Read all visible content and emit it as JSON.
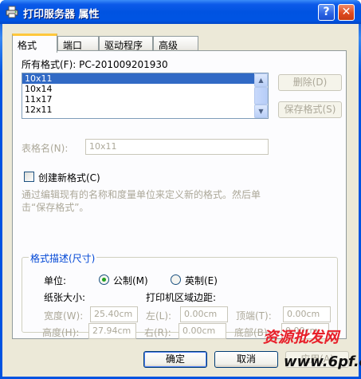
{
  "window": {
    "title": "打印服务器 属性",
    "help_label": "?",
    "close_label": "✕"
  },
  "tabs": [
    {
      "label": "格式",
      "active": true
    },
    {
      "label": "端口",
      "active": false
    },
    {
      "label": "驱动程序",
      "active": false
    },
    {
      "label": "高级",
      "active": false
    }
  ],
  "forms": {
    "label": "所有格式(F): PC-201009201930",
    "items": [
      "10x11",
      "10x14",
      "11x17",
      "12x11"
    ],
    "selected": "10x11",
    "delete_label": "删除(D)",
    "save_label": "保存格式(S)"
  },
  "form_name": {
    "label": "表格名(N):",
    "value": "10x11"
  },
  "create_new": {
    "label": "创建新格式(C)",
    "checked": false
  },
  "hint": "通过编辑现有的名称和度量单位来定义新的格式。然后单击“保存格式”。",
  "description": {
    "title": "格式描述(尺寸)",
    "unit_label": "单位:",
    "metric_label": "公制(M)",
    "english_label": "英制(E)",
    "selected_unit": "metric",
    "paper_size_label": "纸张大小:",
    "width_label": "宽度(W):",
    "width_value": "25.40cm",
    "height_label": "高度(H):",
    "height_value": "27.94cm",
    "margins_label": "打印机区域边距:",
    "left_label": "左(L):",
    "left_value": "0.00cm",
    "right_label": "右(R):",
    "right_value": "0.00cm",
    "top_label": "顶端(T):",
    "top_value": "0.00cm",
    "bottom_label": "底部(B):",
    "bottom_value": "0.00cm"
  },
  "footer": {
    "ok_label": "确定",
    "cancel_label": "取消",
    "apply_label": "应用(A)"
  },
  "watermark": {
    "line1": "资源批发网",
    "line2": "www.6pf.cn"
  }
}
